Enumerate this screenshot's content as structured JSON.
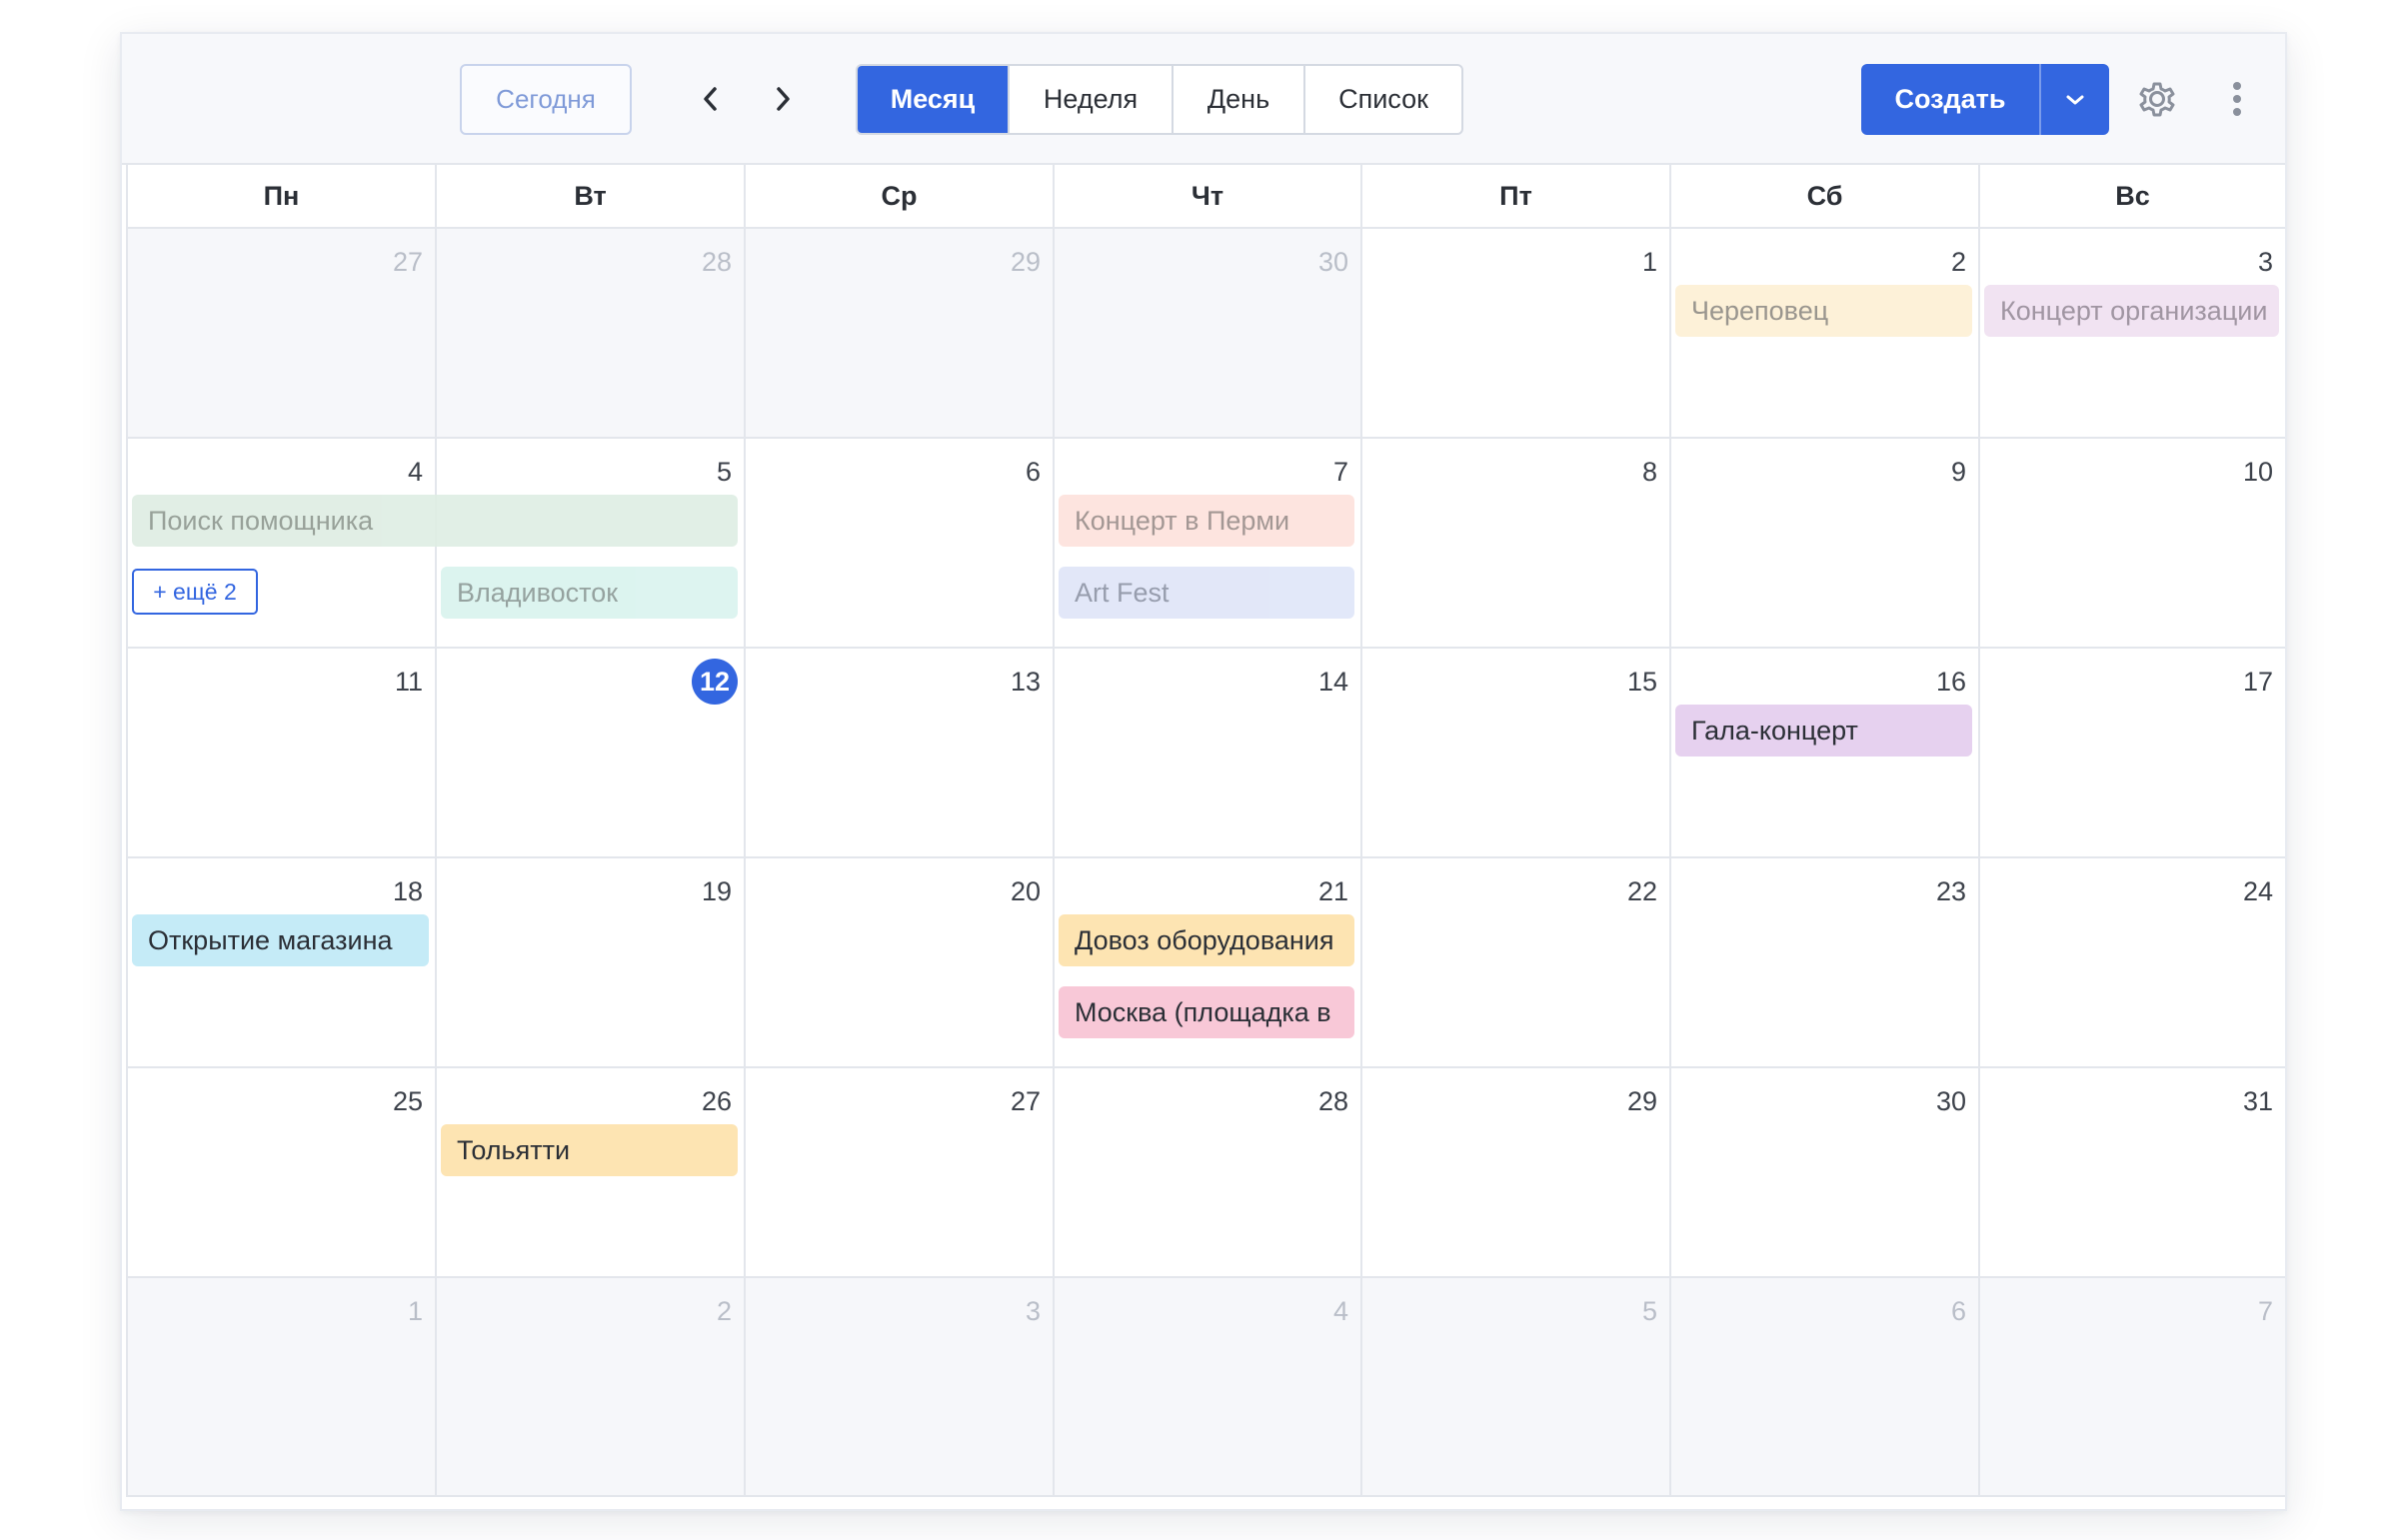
{
  "toolbar": {
    "today_label": "Сегодня",
    "views": [
      {
        "label": "Месяц",
        "active": true
      },
      {
        "label": "Неделя",
        "active": false
      },
      {
        "label": "День",
        "active": false
      },
      {
        "label": "Список",
        "active": false
      }
    ],
    "create_label": "Создать"
  },
  "colors": {
    "accent": "#3366e0"
  },
  "weekdays": [
    "Пн",
    "Вт",
    "Ср",
    "Чт",
    "Пт",
    "Сб",
    "Вс"
  ],
  "weeks": [
    [
      {
        "d": "27",
        "o": true
      },
      {
        "d": "28",
        "o": true
      },
      {
        "d": "29",
        "o": true
      },
      {
        "d": "30",
        "o": true
      },
      {
        "d": "1"
      },
      {
        "d": "2"
      },
      {
        "d": "3"
      }
    ],
    [
      {
        "d": "4"
      },
      {
        "d": "5"
      },
      {
        "d": "6"
      },
      {
        "d": "7"
      },
      {
        "d": "8"
      },
      {
        "d": "9"
      },
      {
        "d": "10"
      }
    ],
    [
      {
        "d": "11"
      },
      {
        "d": "12",
        "today": true
      },
      {
        "d": "13"
      },
      {
        "d": "14"
      },
      {
        "d": "15"
      },
      {
        "d": "16"
      },
      {
        "d": "17"
      }
    ],
    [
      {
        "d": "18"
      },
      {
        "d": "19"
      },
      {
        "d": "20"
      },
      {
        "d": "21"
      },
      {
        "d": "22"
      },
      {
        "d": "23"
      },
      {
        "d": "24"
      }
    ],
    [
      {
        "d": "25"
      },
      {
        "d": "26"
      },
      {
        "d": "27"
      },
      {
        "d": "28"
      },
      {
        "d": "29"
      },
      {
        "d": "30"
      },
      {
        "d": "31"
      }
    ],
    [
      {
        "d": "1",
        "o": true
      },
      {
        "d": "2",
        "o": true
      },
      {
        "d": "3",
        "o": true
      },
      {
        "d": "4",
        "o": true
      },
      {
        "d": "5",
        "o": true
      },
      {
        "d": "6",
        "o": true
      },
      {
        "d": "7",
        "o": true
      }
    ]
  ],
  "events": [
    {
      "title": "Череповец",
      "week": 0,
      "day": 5,
      "span": 1,
      "slot": 0,
      "bg": "#fdf0d4",
      "fg": "#8e8a82",
      "past": true
    },
    {
      "title": "Концерт организации",
      "week": 0,
      "day": 6,
      "span": 1,
      "slot": 0,
      "bg": "#f0e1f1",
      "fg": "#968a99",
      "past": true
    },
    {
      "title": "Поиск помощника",
      "week": 1,
      "day": 0,
      "span": 2,
      "slot": 0,
      "bg": "#deede3",
      "fg": "#8d978f",
      "past": true
    },
    {
      "title": "Владивосток",
      "week": 1,
      "day": 1,
      "span": 1,
      "slot": 1,
      "bg": "#d9f3ee",
      "fg": "#8a9895",
      "past": true
    },
    {
      "title": "Концерт в Перми",
      "week": 1,
      "day": 3,
      "span": 1,
      "slot": 0,
      "bg": "#fde2dc",
      "fg": "#9a8c89",
      "past": true
    },
    {
      "title": "Art Fest",
      "week": 1,
      "day": 3,
      "span": 1,
      "slot": 1,
      "bg": "#dfe5f8",
      "fg": "#8c93a5",
      "past": true
    },
    {
      "title": "Гала-концерт",
      "week": 2,
      "day": 5,
      "span": 1,
      "slot": 0,
      "bg": "#e6d1ef",
      "fg": "#2b2f36"
    },
    {
      "title": "Открытие магазина",
      "week": 3,
      "day": 0,
      "span": 1,
      "slot": 0,
      "bg": "#c5ebf7",
      "fg": "#2b2f36"
    },
    {
      "title": "Довоз оборудования",
      "week": 3,
      "day": 3,
      "span": 1,
      "slot": 0,
      "bg": "#fde4b2",
      "fg": "#2b2f36"
    },
    {
      "title": "Москва (площадка в",
      "week": 3,
      "day": 3,
      "span": 1,
      "slot": 1,
      "bg": "#f8c8d7",
      "fg": "#2b2f36"
    },
    {
      "title": "Тольятти",
      "week": 4,
      "day": 1,
      "span": 1,
      "slot": 0,
      "bg": "#fde4b2",
      "fg": "#2b2f36"
    }
  ],
  "more_links": [
    {
      "label": "+ ещё 2",
      "week": 1,
      "day": 0
    }
  ]
}
